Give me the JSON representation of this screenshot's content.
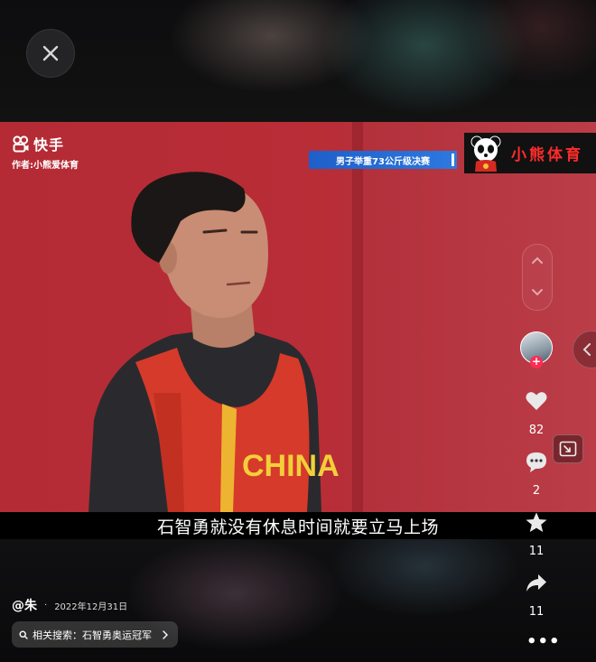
{
  "video": {
    "watermark": "快手",
    "author": "作者:小熊爱体育",
    "event_banner": "男子举重73公斤级决赛",
    "channel_name": "小熊体育",
    "jersey_text": "CHINA",
    "subtitle": "石智勇就没有休息时间就要立马上场"
  },
  "rail": {
    "likes": "82",
    "comments": "2",
    "favorites": "11",
    "shares": "11",
    "more": "•••"
  },
  "footer": {
    "username": "@朱",
    "separator": "·",
    "date": "2022年12月31日",
    "related_search": "相关搜索：石智勇奥运冠军"
  },
  "colors": {
    "background": "#000000",
    "video_red": "#b92d37",
    "banner_blue": "#2c79e0",
    "brand_red": "#ff2b2b",
    "follow_pink": "#fe2c55"
  }
}
